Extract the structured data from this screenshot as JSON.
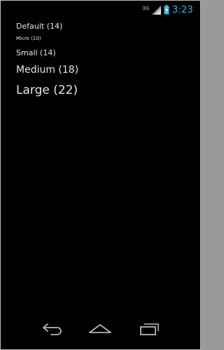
{
  "status_bar": {
    "network_type": "3G",
    "time": "3:23",
    "accent_color": "#33b5e5",
    "icons": [
      "signal-icon",
      "battery-charging-icon"
    ]
  },
  "text_samples": [
    {
      "label": "Default (14)"
    },
    {
      "label": "Micro (10)"
    },
    {
      "label": "Small (14)"
    },
    {
      "label": "Medium (18)"
    },
    {
      "label": "Large (22)"
    }
  ],
  "nav_bar": {
    "buttons": [
      "back-icon",
      "home-icon",
      "recent-apps-icon"
    ]
  }
}
